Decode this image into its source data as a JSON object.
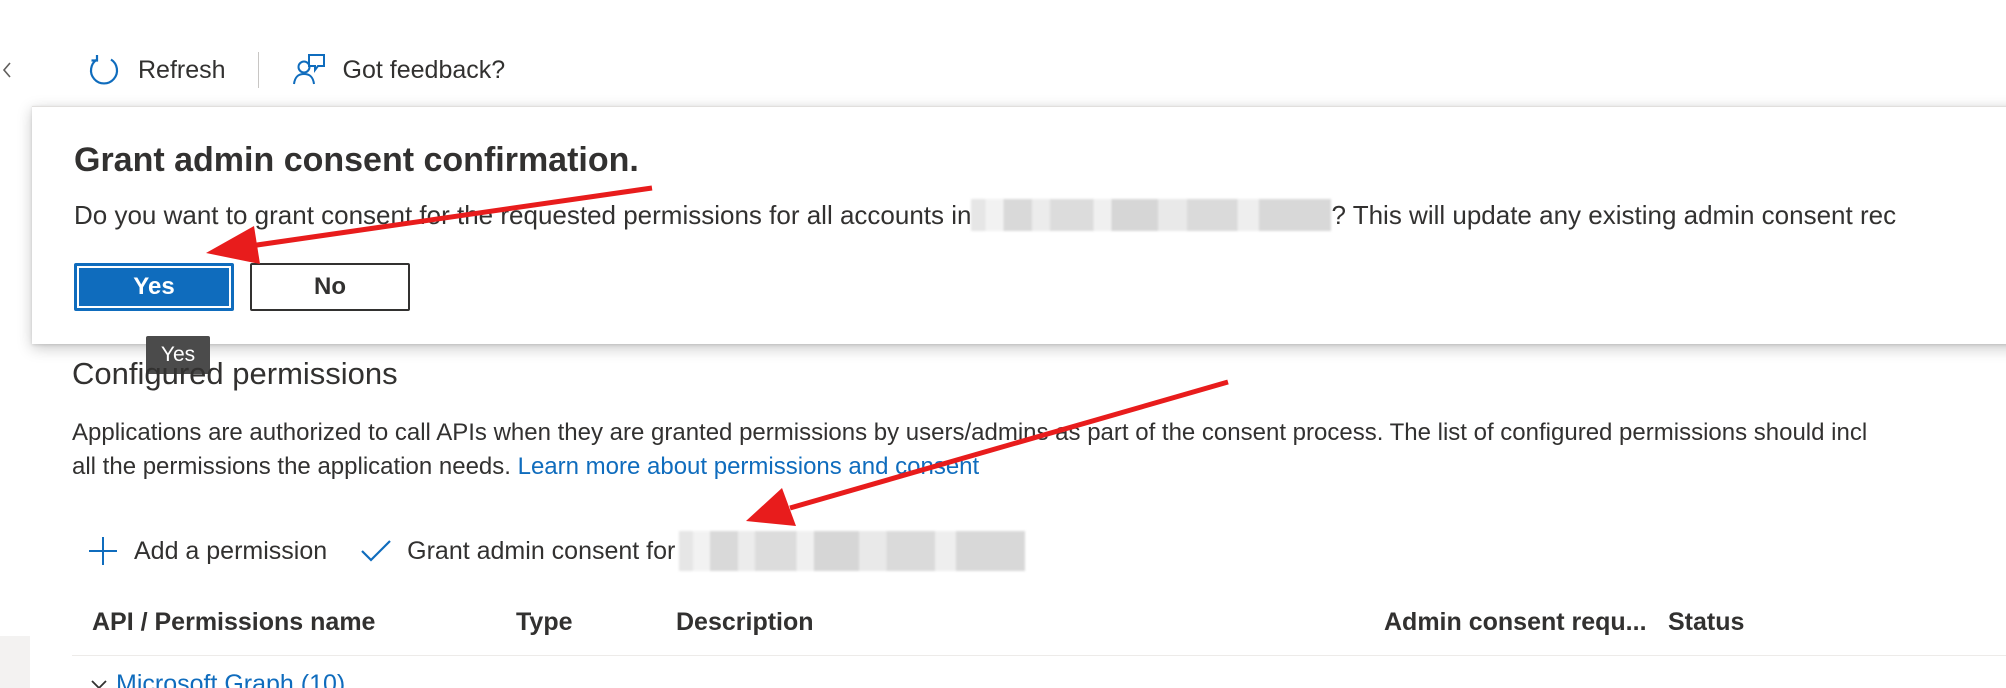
{
  "command_bar": {
    "refresh_label": "Refresh",
    "feedback_label": "Got feedback?"
  },
  "confirmation": {
    "title": "Grant admin consent confirmation.",
    "message_before": "Do you want to grant consent for the requested permissions for all accounts in ",
    "message_after": "? This will update any existing admin consent rec",
    "yes_label": "Yes",
    "no_label": "No",
    "tooltip": "Yes"
  },
  "permissions": {
    "title": "Configured permissions",
    "description": "Applications are authorized to call APIs when they are granted permissions by users/admins as part of the consent process. The list of configured permissions should incl all the permissions the application needs.",
    "description_line1": "Applications are authorized to call APIs when they are granted permissions by users/admins as part of the consent process. The list of configured permissions should incl",
    "description_line2": "all the permissions the application needs. ",
    "learn_more_label": "Learn more about permissions and consent",
    "add_permission_label": "Add a permission",
    "grant_consent_label": "Grant admin consent for",
    "columns": [
      "API / Permissions name",
      "Type",
      "Description",
      "Admin consent requ...",
      "Status"
    ],
    "groups": [
      {
        "label": "Microsoft Graph (10)"
      }
    ]
  },
  "colors": {
    "accent": "#0f6cbd",
    "annotation": "#e81c1c"
  },
  "icons": [
    "chevron-left-icon",
    "refresh-icon",
    "feedback-icon",
    "add-icon",
    "checkmark-icon",
    "chevron-down-icon"
  ]
}
